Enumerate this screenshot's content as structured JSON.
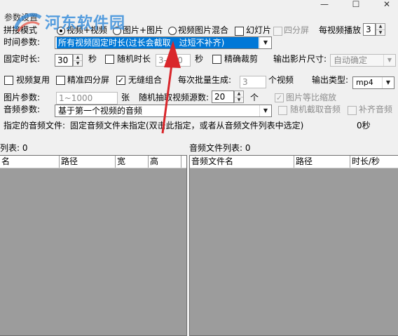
{
  "window": {
    "minimize_glyph": "—",
    "maximize_glyph": "☐",
    "close_glyph": "✕"
  },
  "watermark": "河东软件园",
  "params": {
    "section_label": "参数设置",
    "stitch_mode_label": "拼接模式",
    "mode_options": [
      "视频+视频",
      "图片+图片",
      "视频图片混合",
      "幻灯片",
      "四分屏"
    ],
    "video_play_label": "每视频播放",
    "video_play_value": "3",
    "time_param_label": "时间参数:",
    "time_param_value": "所有视频固定时长(过长会截取，过短不补齐)",
    "fixed_duration_label": "固定时长:",
    "fixed_duration_value": "30",
    "seconds_unit": "秒",
    "random_duration_label": "随机时长",
    "random_duration_value": "3-100",
    "precise_crop_label": "精确裁剪",
    "output_size_label": "输出影片尺寸:",
    "output_size_value": "自动确定",
    "reuse_video_label": "视频复用",
    "precise_quad_label": "精准四分屏",
    "seamless_label": "无缝组合",
    "batch_label": "每次批量生成:",
    "batch_value": "3",
    "batch_unit": "个视频",
    "output_type_label": "输出类型:",
    "output_type_value": "mp4",
    "image_param_label": "图片参数:",
    "image_param_value": "1~1000",
    "image_unit": "张",
    "random_source_label": "随机抽取视频源数:",
    "random_source_value": "20",
    "random_source_unit": "个",
    "image_scale_label": "图片等比缩放",
    "audio_param_label": "音频参数:",
    "audio_param_value": "基于第一个视频的音频",
    "random_audio_label": "随机截取音频",
    "fill_audio_label": "补齐音频",
    "audio_file_label": "指定的音频文件:",
    "audio_file_value": "固定音频文件未指定(双击此指定，或者从音频文件列表中选定)",
    "audio_duration": "0秒"
  },
  "video_list": {
    "title": "列表: 0",
    "columns": [
      "名",
      "路径",
      "宽",
      "高"
    ]
  },
  "audio_list": {
    "title": "音频文件列表: 0",
    "columns": [
      "音频文件名",
      "路径",
      "时长/秒"
    ]
  },
  "annotation": {
    "arrow_color": "#d9262b"
  }
}
